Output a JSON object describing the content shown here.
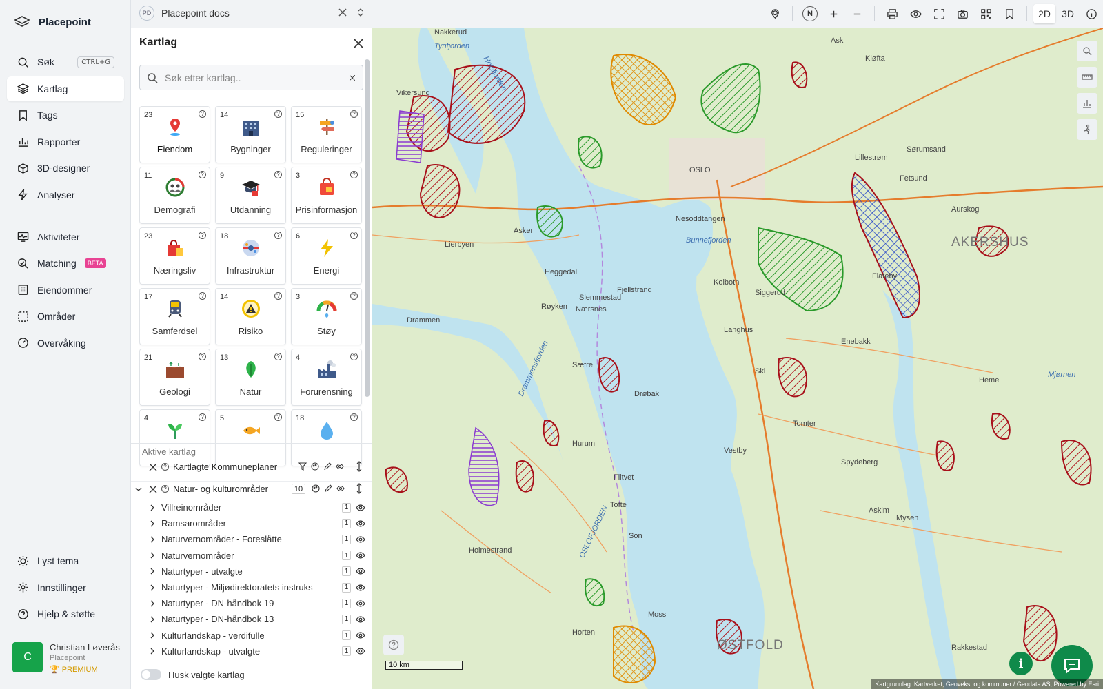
{
  "app": {
    "name": "Placepoint",
    "brand_color": "#16a34a"
  },
  "nav": {
    "items": [
      {
        "label": "Søk",
        "icon": "search-icon",
        "shortcut": "CTRL+G"
      },
      {
        "label": "Kartlag",
        "icon": "layers-icon",
        "active": true
      },
      {
        "label": "Tags",
        "icon": "bookmark-icon"
      },
      {
        "label": "Rapporter",
        "icon": "bar-chart-icon"
      },
      {
        "label": "3D-designer",
        "icon": "cube-icon"
      },
      {
        "label": "Analyser",
        "icon": "lightning-icon"
      },
      {
        "label": "Aktiviteter",
        "icon": "activity-icon"
      },
      {
        "label": "Matching",
        "icon": "match-icon",
        "badge": "BETA"
      },
      {
        "label": "Eiendommer",
        "icon": "building-icon"
      },
      {
        "label": "Områder",
        "icon": "area-icon"
      },
      {
        "label": "Overvåking",
        "icon": "gauge-icon"
      }
    ],
    "bottom": [
      {
        "label": "Lyst tema",
        "icon": "sun-icon"
      },
      {
        "label": "Innstillinger",
        "icon": "gear-icon"
      },
      {
        "label": "Hjelp & støtte",
        "icon": "help-icon"
      }
    ]
  },
  "user": {
    "initial": "C",
    "name": "Christian Løverås",
    "org": "Placepoint",
    "plan": "PREMIUM"
  },
  "topbar": {
    "doc_badge": "PD",
    "doc_title": "Placepoint docs",
    "north": "N",
    "mode_2d": "2D",
    "mode_3d": "3D"
  },
  "panel": {
    "title": "Kartlag",
    "search_placeholder": "Søk etter kartlag..",
    "tiles": [
      {
        "count": "23",
        "label": "Eiendom",
        "icon": "location-pin-icon"
      },
      {
        "count": "14",
        "label": "Bygninger",
        "icon": "buildings-icon"
      },
      {
        "count": "15",
        "label": "Reguleringer",
        "icon": "signpost-icon"
      },
      {
        "count": "11",
        "label": "Demografi",
        "icon": "population-icon"
      },
      {
        "count": "9",
        "label": "Utdanning",
        "icon": "graduation-icon"
      },
      {
        "count": "3",
        "label": "Prisinformasjon",
        "icon": "price-tag-icon"
      },
      {
        "count": "23",
        "label": "Næringsliv",
        "icon": "shopping-bag-icon"
      },
      {
        "count": "18",
        "label": "Infrastruktur",
        "icon": "infrastructure-icon"
      },
      {
        "count": "6",
        "label": "Energi",
        "icon": "lightning-icon"
      },
      {
        "count": "17",
        "label": "Samferdsel",
        "icon": "train-icon"
      },
      {
        "count": "14",
        "label": "Risiko",
        "icon": "warning-icon"
      },
      {
        "count": "3",
        "label": "Støy",
        "icon": "noise-gauge-icon"
      },
      {
        "count": "21",
        "label": "Geologi",
        "icon": "soil-icon"
      },
      {
        "count": "13",
        "label": "Natur",
        "icon": "leaf-icon"
      },
      {
        "count": "4",
        "label": "Forurensning",
        "icon": "factory-icon"
      },
      {
        "count": "4",
        "label": "",
        "icon": "plant-icon"
      },
      {
        "count": "5",
        "label": "",
        "icon": "fish-icon"
      },
      {
        "count": "18",
        "label": "",
        "icon": "water-drop-icon"
      }
    ],
    "active_title": "Aktive kartlag",
    "active_layers": [
      {
        "name": "Kartlagte Kommuneplaner"
      },
      {
        "name": "Natur- og kulturområder",
        "count": "10",
        "expanded": true
      }
    ],
    "sublayers": [
      {
        "name": "Villreinområder",
        "count": "1"
      },
      {
        "name": "Ramsarområder",
        "count": "1"
      },
      {
        "name": "Naturvernområder - Foreslåtte",
        "count": "1"
      },
      {
        "name": "Naturvernområder",
        "count": "1"
      },
      {
        "name": "Naturtyper - utvalgte",
        "count": "1"
      },
      {
        "name": "Naturtyper - Miljødirektoratets instruks",
        "count": "1"
      },
      {
        "name": "Naturtyper - DN-håndbok 19",
        "count": "1"
      },
      {
        "name": "Naturtyper - DN-håndbok 13",
        "count": "1"
      },
      {
        "name": "Kulturlandskap - verdifulle",
        "count": "1"
      },
      {
        "name": "Kulturlandskap - utvalgte",
        "count": "1"
      }
    ],
    "remember_label": "Husk valgte kartlag"
  },
  "map": {
    "labels": [
      {
        "t": "Nakkerud",
        "k": ""
      },
      {
        "t": "Tyrifjorden",
        "k": "water"
      },
      {
        "t": "Holsfjorden",
        "k": "water"
      },
      {
        "t": "Vikersund",
        "k": ""
      },
      {
        "t": "Heggedal",
        "k": ""
      },
      {
        "t": "Asker",
        "k": ""
      },
      {
        "t": "Lierbyen",
        "k": ""
      },
      {
        "t": "Drammen",
        "k": ""
      },
      {
        "t": "Røyken",
        "k": ""
      },
      {
        "t": "Slemmestad",
        "k": ""
      },
      {
        "t": "Nærsnes",
        "k": ""
      },
      {
        "t": "Fjellstrand",
        "k": ""
      },
      {
        "t": "Sætre",
        "k": ""
      },
      {
        "t": "Drøbak",
        "k": ""
      },
      {
        "t": "Hurum",
        "k": ""
      },
      {
        "t": "Holmestrand",
        "k": ""
      },
      {
        "t": "Horten",
        "k": ""
      },
      {
        "t": "Filtvet",
        "k": ""
      },
      {
        "t": "Tofte",
        "k": ""
      },
      {
        "t": "OSLOFJORDEN",
        "k": "water"
      },
      {
        "t": "Kolbotn",
        "k": ""
      },
      {
        "t": "Langhus",
        "k": ""
      },
      {
        "t": "Ski",
        "k": ""
      },
      {
        "t": "Vestby",
        "k": ""
      },
      {
        "t": "Son",
        "k": ""
      },
      {
        "t": "Moss",
        "k": ""
      },
      {
        "t": "Tomter",
        "k": ""
      },
      {
        "t": "Spydeberg",
        "k": ""
      },
      {
        "t": "Askim",
        "k": ""
      },
      {
        "t": "Mysen",
        "k": ""
      },
      {
        "t": "Rakkestad",
        "k": ""
      },
      {
        "t": "Siggerud",
        "k": ""
      },
      {
        "t": "Enebakk",
        "k": ""
      },
      {
        "t": "Fetsund",
        "k": ""
      },
      {
        "t": "Sørumsand",
        "k": ""
      },
      {
        "t": "Flateby",
        "k": ""
      },
      {
        "t": "Heme",
        "k": ""
      },
      {
        "t": "Lillestrøm",
        "k": ""
      },
      {
        "t": "OSLO",
        "k": ""
      },
      {
        "t": "Nesoddtangen",
        "k": ""
      },
      {
        "t": "Bunnefjorden",
        "k": "water"
      },
      {
        "t": "Drammensfjorden",
        "k": "water"
      },
      {
        "t": "AKERSHUS",
        "k": "big"
      },
      {
        "t": "ØSTFOLD",
        "k": "big"
      },
      {
        "t": "Ask",
        "k": ""
      },
      {
        "t": "Kløfta",
        "k": ""
      },
      {
        "t": "Aurskog",
        "k": ""
      },
      {
        "t": "Mjørnen",
        "k": "water"
      }
    ],
    "scale": "10 km",
    "attribution": "Kartgrunnlag: Kartverket, Geovekst og kommuner / Geodata AS, Powered by Esri"
  }
}
